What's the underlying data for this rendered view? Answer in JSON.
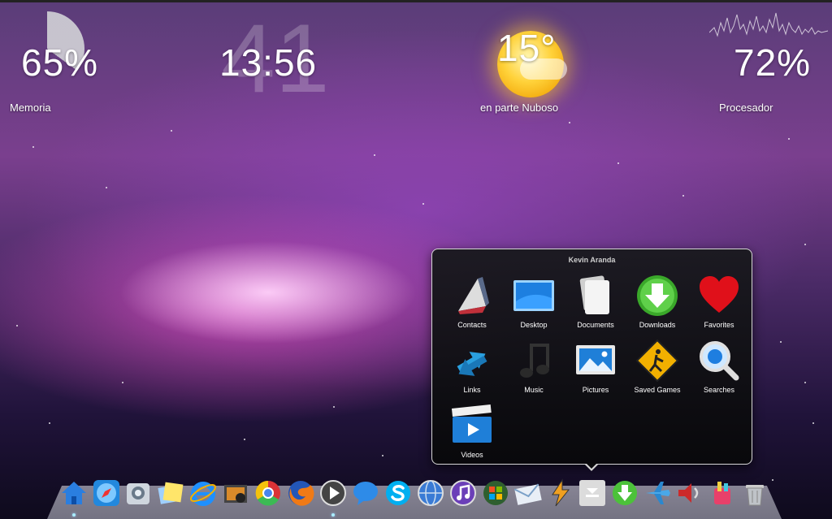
{
  "widgets": {
    "memory": {
      "value": "65%",
      "label": "Memoria",
      "fraction": 0.65
    },
    "clock": {
      "time": "13:56",
      "seconds": "41"
    },
    "weather": {
      "temperature": "15°",
      "condition": "en parte Nuboso"
    },
    "cpu": {
      "value": "72%",
      "label": "Procesador"
    }
  },
  "stack": {
    "title": "Kevin Aranda",
    "items": [
      {
        "label": "Contacts",
        "icon": "contacts-icon"
      },
      {
        "label": "Desktop",
        "icon": "desktop-folder-icon"
      },
      {
        "label": "Documents",
        "icon": "documents-icon"
      },
      {
        "label": "Downloads",
        "icon": "downloads-icon"
      },
      {
        "label": "Favorites",
        "icon": "heart-icon"
      },
      {
        "label": "Links",
        "icon": "links-icon"
      },
      {
        "label": "Music",
        "icon": "music-note-icon"
      },
      {
        "label": "Pictures",
        "icon": "pictures-icon"
      },
      {
        "label": "Saved Games",
        "icon": "saved-games-icon"
      },
      {
        "label": "Searches",
        "icon": "magnifier-icon"
      },
      {
        "label": "Videos",
        "icon": "clapperboard-icon"
      }
    ]
  },
  "dock": [
    "home-icon",
    "safari-icon",
    "finder-icon",
    "sticky-notes-icon",
    "internet-explorer-icon",
    "photo-icon",
    "chrome-icon",
    "firefox-icon",
    "media-player-icon",
    "messenger-icon",
    "skype-icon",
    "globe-icon",
    "itunes-icon",
    "windows-icon",
    "mail-icon",
    "winamp-icon",
    "stack-folder-icon",
    "download-arrow-icon",
    "airplane-icon",
    "volume-icon",
    "paint-icon",
    "trash-icon"
  ],
  "colors": {
    "accent": "#1e88e5",
    "popup_border": "#d7d7d7"
  }
}
